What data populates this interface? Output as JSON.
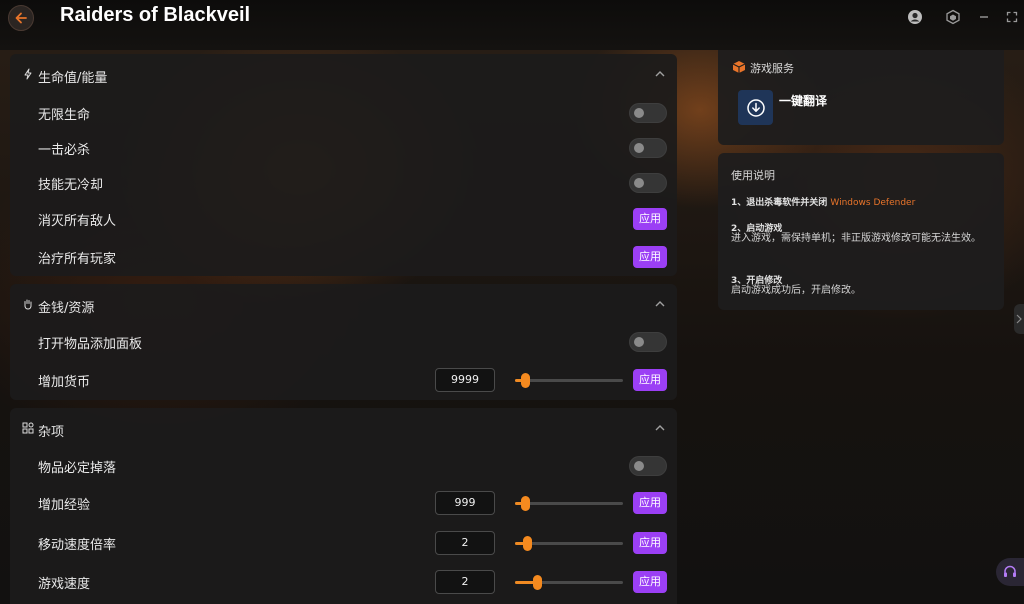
{
  "app": {
    "title": "Raiders of Blackveil"
  },
  "colors": {
    "accent_apply": "#9b3ff5",
    "slider_orange": "#f58a1f",
    "link_orange": "#e8742a",
    "back_button": "#e8742a"
  },
  "icons": {
    "back": "arrow-left-icon",
    "user": "user-icon",
    "cube": "cube-icon",
    "minimize": "minimize-icon",
    "maximize": "expand-icon",
    "support": "headset-icon"
  },
  "sections": [
    {
      "title": "生命值/能量",
      "icon": "lightning-icon",
      "rows": [
        {
          "label": "无限生命",
          "control": "toggle",
          "on": false
        },
        {
          "label": "一击必杀",
          "control": "toggle",
          "on": false
        },
        {
          "label": "技能无冷却",
          "control": "toggle",
          "on": false
        },
        {
          "label": "消灭所有敌人",
          "control": "apply",
          "button": "应用"
        },
        {
          "label": "治疗所有玩家",
          "control": "apply",
          "button": "应用"
        }
      ]
    },
    {
      "title": "金钱/资源",
      "icon": "hand-icon",
      "rows": [
        {
          "label": "打开物品添加面板",
          "control": "toggle",
          "on": false
        },
        {
          "label": "增加货币",
          "control": "slider",
          "value": "9999",
          "slider_fraction": 0.09,
          "button": "应用"
        }
      ]
    },
    {
      "title": "杂项",
      "icon": "grid-icon",
      "rows": [
        {
          "label": "物品必定掉落",
          "control": "toggle",
          "on": false
        },
        {
          "label": "增加经验",
          "control": "slider",
          "value": "999",
          "slider_fraction": 0.09,
          "button": "应用"
        },
        {
          "label": "移动速度倍率",
          "control": "slider",
          "value": "2",
          "slider_fraction": 0.11,
          "button": "应用"
        },
        {
          "label": "游戏速度",
          "control": "slider",
          "value": "2",
          "slider_fraction": 0.2,
          "button": "应用"
        }
      ]
    }
  ],
  "service": {
    "title": "游戏服务",
    "translate_label": "一键翻译"
  },
  "instructions": {
    "title": "使用说明",
    "step1_head": "1、退出杀毒软件并关闭",
    "step1_link": "Windows Defender",
    "step2_head": "2、启动游戏",
    "step2_body": "进入游戏，需保持单机；非正版游戏修改可能无法生效。",
    "step3_head": "3、开启修改",
    "step3_body": "启动游戏成功后，开启修改。"
  }
}
